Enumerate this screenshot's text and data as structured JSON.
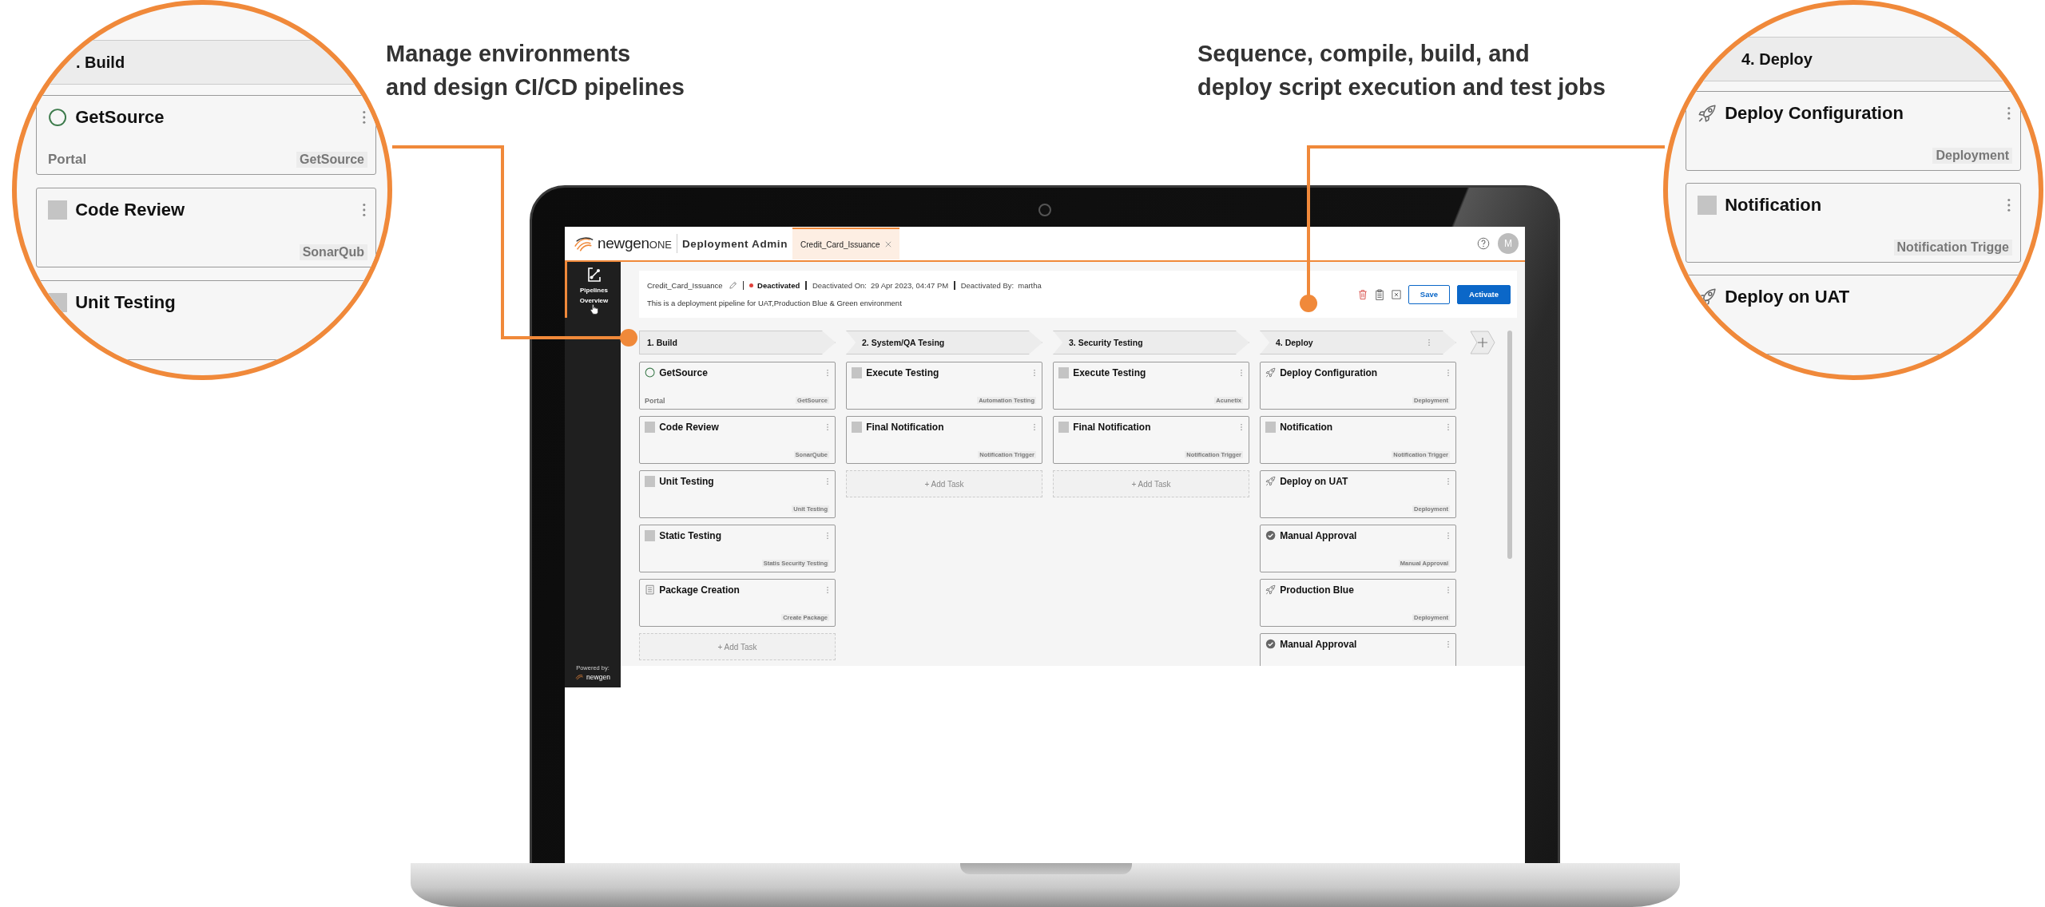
{
  "callouts": [
    {
      "heading": "Manage environments\nand design CI/CD pipelines",
      "lens": {
        "stage": ". Build",
        "tasks": [
          {
            "kind": "circle",
            "title": "GetSource",
            "source": "Portal",
            "tag": "GetSource"
          },
          {
            "kind": "square",
            "title": "Code Review",
            "tag": "SonarQub"
          },
          {
            "kind": "square",
            "title": "Unit Testing"
          }
        ]
      }
    },
    {
      "heading": "Sequence, compile, build, and\ndeploy script execution and test jobs",
      "lens": {
        "stage": "4. Deploy",
        "tasks": [
          {
            "kind": "rocket",
            "title": "Deploy Configuration",
            "tag": "Deployment"
          },
          {
            "kind": "square",
            "title": "Notification",
            "tag": "Notification Trigge"
          },
          {
            "kind": "rocket",
            "title": "Deploy on UAT"
          }
        ]
      }
    }
  ],
  "app": {
    "brand": {
      "name": "newgen",
      "suffix": "ONE"
    },
    "module": "Deployment Admin",
    "tabs": [
      {
        "label": "Credit_Card_Issuance",
        "selected": true
      }
    ],
    "user_initial": "M",
    "sidebar": {
      "items": [
        {
          "label": "Pipelines Overview",
          "selected": true
        }
      ],
      "powered_by": "Powered by:",
      "powered_brand": "newgen"
    },
    "pipeline": {
      "name": "Credit_Card_Issuance",
      "status": "Deactivated",
      "deactivated_on_label": "Deactivated On:",
      "deactivated_on": "29 Apr 2023, 04:47 PM",
      "deactivated_by_label": "Deactivated By:",
      "deactivated_by": "martha",
      "description": "This is a deployment pipeline for UAT,Production Blue & Green environment"
    },
    "actions": [
      {
        "label": "Save",
        "kind": "outline"
      },
      {
        "label": "Activate",
        "kind": "primary"
      }
    ],
    "stages": [
      {
        "title": "1. Build",
        "has_menu": false,
        "add_task": "+ Add Task",
        "tasks": [
          {
            "kind": "circle",
            "title": "GetSource",
            "source": "Portal",
            "tag": "GetSource"
          },
          {
            "kind": "square",
            "title": "Code Review",
            "tag": "SonarQube"
          },
          {
            "kind": "square",
            "title": "Unit Testing",
            "tag": "Unit Testing"
          },
          {
            "kind": "square",
            "title": "Static Testing",
            "tag": "Statis Security Testing"
          },
          {
            "kind": "doc",
            "title": "Package Creation",
            "tag": "Create Package"
          }
        ]
      },
      {
        "title": "2. System/QA Tesing",
        "has_menu": false,
        "add_task": "+ Add Task",
        "tasks": [
          {
            "kind": "square",
            "title": "Execute Testing",
            "tag": "Automation Testing"
          },
          {
            "kind": "square",
            "title": "Final Notification",
            "tag": "Notification Trigger"
          }
        ]
      },
      {
        "title": "3. Security Testing",
        "has_menu": false,
        "add_task": "+ Add Task",
        "tasks": [
          {
            "kind": "square",
            "title": "Execute Testing",
            "tag": "Acunetix"
          },
          {
            "kind": "square",
            "title": "Final Notification",
            "tag": "Notification Trigger"
          }
        ]
      },
      {
        "title": "4. Deploy",
        "has_menu": true,
        "tasks": [
          {
            "kind": "rocket",
            "title": "Deploy Configuration",
            "tag": "Deployment"
          },
          {
            "kind": "square",
            "title": "Notification",
            "tag": "Notification Trigger"
          },
          {
            "kind": "rocket",
            "title": "Deploy on UAT",
            "tag": "Deployment"
          },
          {
            "kind": "check",
            "title": "Manual Approval",
            "tag": "Manual Approval"
          },
          {
            "kind": "rocket",
            "title": "Production Blue",
            "tag": "Deployment"
          },
          {
            "kind": "check",
            "title": "Manual Approval"
          }
        ]
      }
    ]
  }
}
